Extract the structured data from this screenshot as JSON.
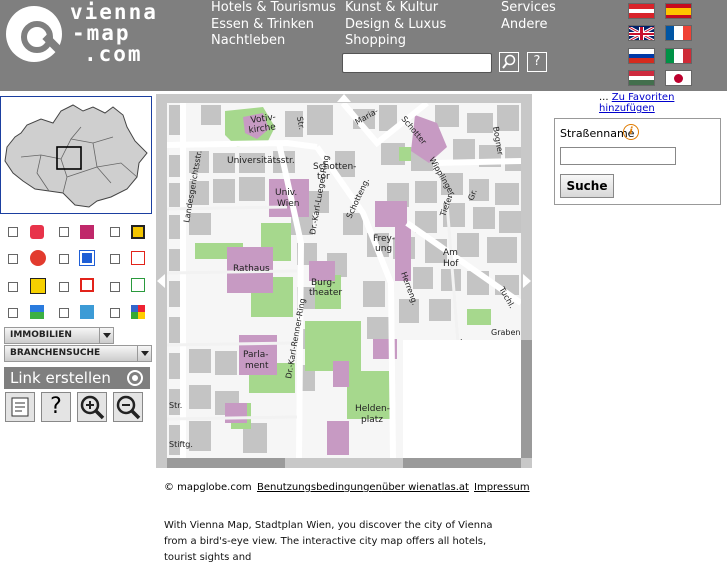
{
  "logo": {
    "line1": "vienna",
    "line2": "-map",
    "line3": ".com"
  },
  "nav": {
    "col1": [
      "Hotels & Tourismus",
      "Essen & Trinken",
      "Nachtleben"
    ],
    "col2": [
      "Kunst & Kultur",
      "Design & Luxus",
      "Shopping"
    ],
    "col3": [
      "Services",
      "Andere"
    ]
  },
  "search": {
    "value": "",
    "search_icon": "magnifier-icon",
    "help_label": "?"
  },
  "languages": [
    "Austria",
    "Spain",
    "United Kingdom",
    "France",
    "Russia",
    "Italy",
    "Hungary",
    "Japan"
  ],
  "favorites": {
    "prefix": "...",
    "label": "Zu Favoriten hinzufügen"
  },
  "categories": {
    "icons": [
      "bus-icon",
      "hotel-icon",
      "bank-icon",
      "restaurant-icon",
      "parking-icon",
      "shop-icon",
      "post-icon",
      "pharmacy-icon",
      "hospital-icon",
      "park-icon",
      "museum-icon",
      "event-icon"
    ]
  },
  "dropdowns": {
    "immobilien": "IMMOBILIEN",
    "branchensuche": "BRANCHENSUCHE"
  },
  "link_button": "Link erstellen",
  "tools": [
    "print-icon",
    "help-icon",
    "zoom-in-icon",
    "zoom-out-icon"
  ],
  "tools_help": "?",
  "map": {
    "labels": [
      "Votiv-kirche",
      "Universitätsstr.",
      "Schotten-tor",
      "Univ. Wien",
      "Rathaus",
      "Burg-theater",
      "Parla-ment",
      "Helden-platz",
      "Frey-ung",
      "Herreng.",
      "Am Hof",
      "Tuchl.",
      "Graben",
      "Kohlmarkt",
      "Wipplinger.",
      "Schotteng.",
      "Landesgerichtsstr.",
      "Dr.-Karl-Lueger-Ring",
      "Dr.-Karl-Renner-Ring",
      "Maria-",
      "Schotter",
      "Str.",
      "Tiefer",
      "Gr.",
      "Bogner",
      "Str.",
      "Stiftg."
    ]
  },
  "street_search": {
    "label": "Straßenname",
    "value": "",
    "button": "Suche",
    "info_icon": "info-icon"
  },
  "footer": {
    "copyright": "© mapglobe.com",
    "terms": "Benutzungsbedingungen",
    "about": "über wienatlas.at",
    "imprint": "Impressum"
  },
  "description": "With Vienna Map, Stadtplan Wien, you discover the city of Vienna from a bird's-eye view. The interactive city map offers all hotels, tourist sights and",
  "colors": {
    "header": "#7f7f7f",
    "park": "#a6d88d",
    "building_highlight": "#c79ac3",
    "block": "#c4c4c4"
  }
}
